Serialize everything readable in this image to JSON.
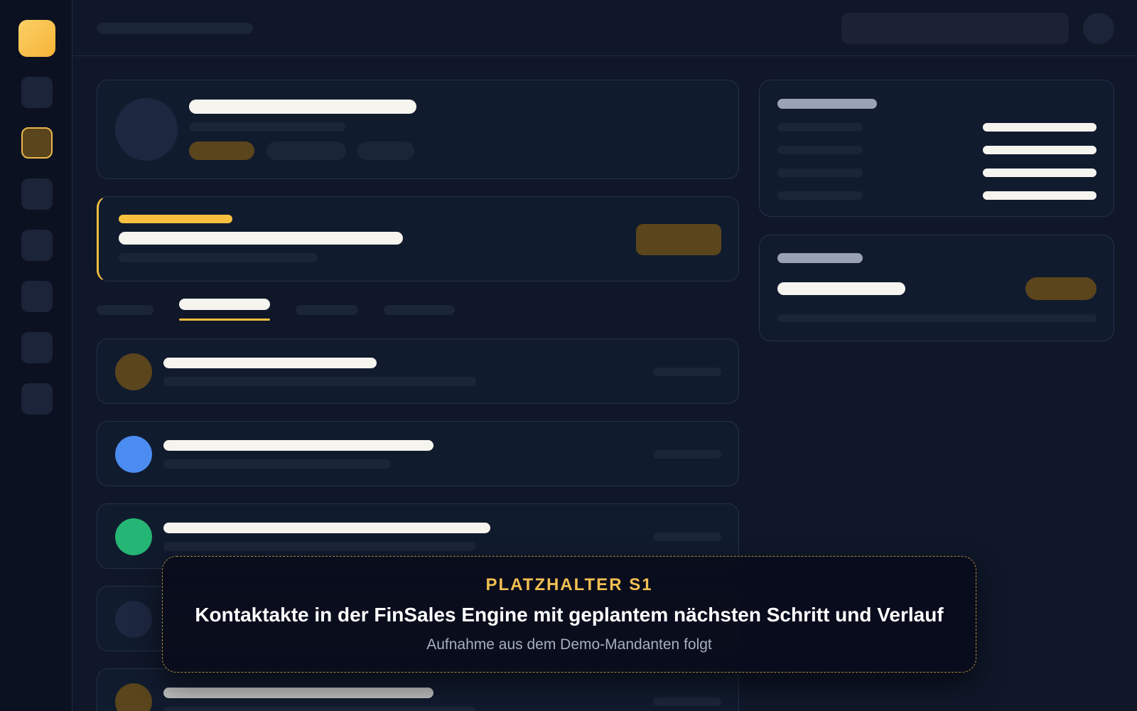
{
  "placeholder": {
    "tag": "PLATZHALTER S1",
    "title": "Kontaktakte in der FinSales Engine mit geplantem nächsten Schritt und Verlauf",
    "subtitle": "Aufnahme aus dem Demo-Mandanten folgt"
  },
  "sidebar": {
    "items": [
      {
        "icon": "nav-icon",
        "active": false
      },
      {
        "icon": "nav-icon",
        "active": true
      },
      {
        "icon": "nav-icon",
        "active": false
      },
      {
        "icon": "nav-icon",
        "active": false
      },
      {
        "icon": "nav-icon",
        "active": false
      },
      {
        "icon": "nav-icon",
        "active": false
      },
      {
        "icon": "nav-icon",
        "active": false
      }
    ]
  },
  "tabs": {
    "active_index": 1,
    "count": 4
  },
  "colors": {
    "background": "#0f1729",
    "sidebar": "#0b1120",
    "accent": "#f6bf3f",
    "accent_muted": "#5a451c",
    "card_border": "#26324a",
    "avatar_blue": "#4b8cf0",
    "avatar_green": "#25b574"
  }
}
